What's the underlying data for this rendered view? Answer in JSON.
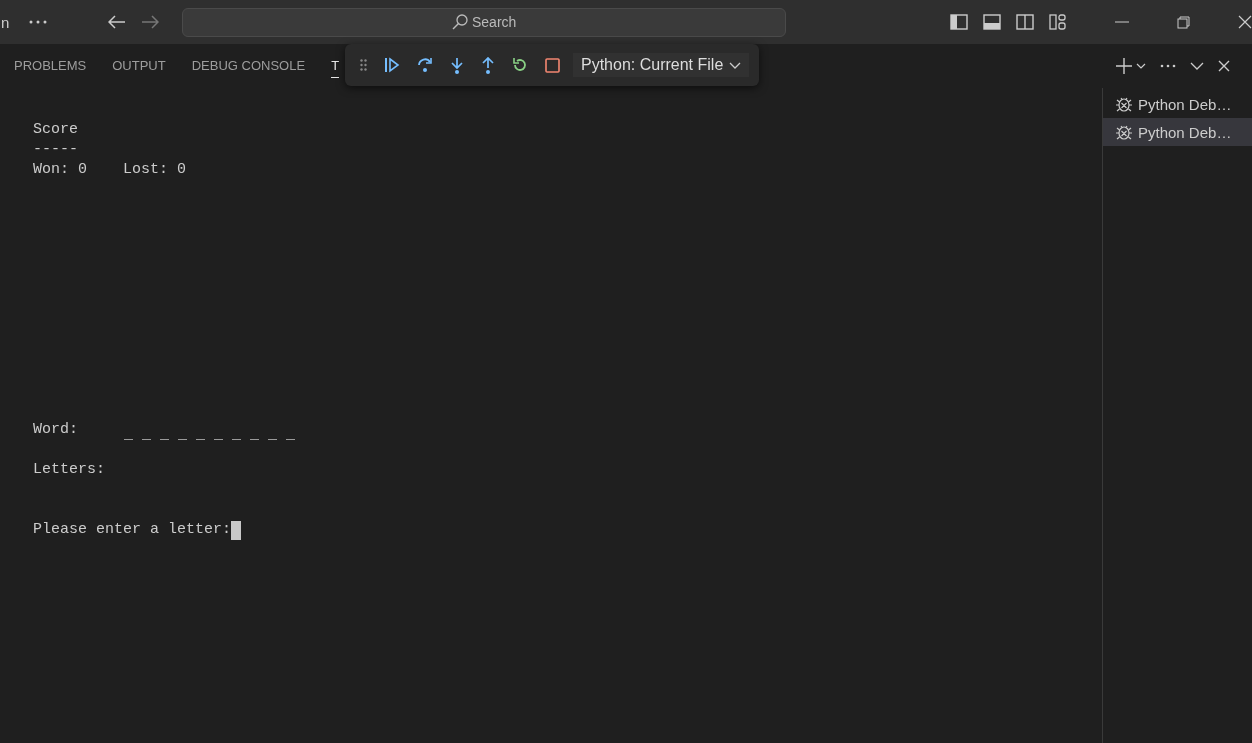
{
  "title_bar": {
    "menu_fragment": "n",
    "search": {
      "label": "Search"
    }
  },
  "panel": {
    "tabs": [
      {
        "label": "PROBLEMS",
        "selected": false
      },
      {
        "label": "OUTPUT",
        "selected": false
      },
      {
        "label": "DEBUG CONSOLE",
        "selected": false
      },
      {
        "label": "T",
        "selected": true
      }
    ]
  },
  "debug_toolbar": {
    "configuration": "Python: Current File"
  },
  "terminal": {
    "score_title": "Score",
    "score_rule": "-----",
    "score_line": "Won: 0    Lost: 0",
    "word_label": "Word:",
    "word_value": "_ _ _ _ _ _ _ _ _ _",
    "letters_label": "Letters:",
    "prompt": "Please enter a letter:"
  },
  "terminals": [
    {
      "label": "Python Deb…",
      "selected": false
    },
    {
      "label": "Python Deb…",
      "selected": true
    }
  ]
}
